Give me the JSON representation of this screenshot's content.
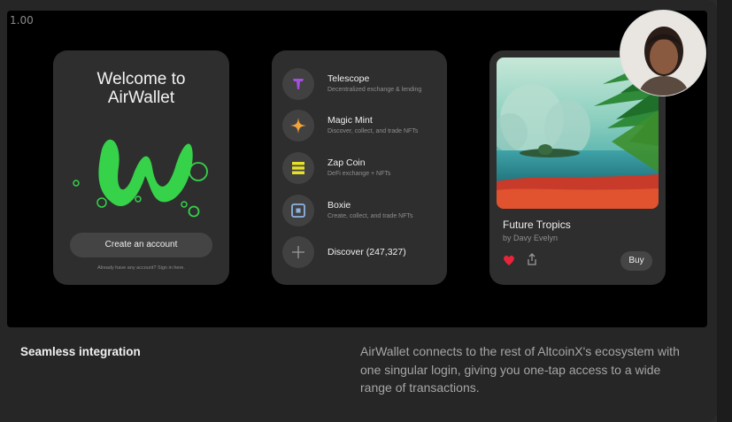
{
  "zoom_label": "1.00",
  "welcome": {
    "title_line1": "Welcome to",
    "title_line2": "AirWallet",
    "create_button": "Create an account",
    "signin_text": "Already have any account? Sign in here."
  },
  "apps": [
    {
      "name": "Telescope",
      "desc": "Decentralized exchange & lending",
      "icon": "telescope-icon",
      "color": "#a34fe0"
    },
    {
      "name": "Magic Mint",
      "desc": "Discover, collect, and trade NFTs",
      "icon": "sparkle-icon",
      "color": "#f2a33a"
    },
    {
      "name": "Zap Coin",
      "desc": "DeFi exchange + NFTs",
      "icon": "zap-coin-icon",
      "color": "#e6e02a"
    },
    {
      "name": "Boxie",
      "desc": "Create, collect, and trade NFTs",
      "icon": "boxie-icon",
      "color": "#8db3e2"
    },
    {
      "name": "Discover (247,327)",
      "icon": "plus-icon"
    }
  ],
  "nft": {
    "title": "Future Tropics",
    "artist": "by Davy Evelyn",
    "buy_label": "Buy",
    "liked": true,
    "heart_color": "#e6243a"
  },
  "section": {
    "heading": "Seamless integration",
    "body": "AirWallet connects to the rest of AltcoinX's ecosystem with one singular login, giving you one-tap access to a wide range of transactions."
  },
  "accent_green": "#35d24a"
}
